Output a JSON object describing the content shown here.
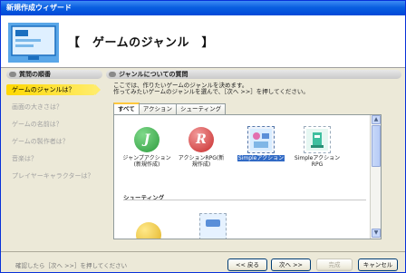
{
  "window": {
    "title": "新規作成ウィザード"
  },
  "banner": {
    "title": "【　ゲームのジャンル　】"
  },
  "sidebar": {
    "header": "質問の順番",
    "steps": [
      "ゲームのジャンルは？",
      "画面の大きさは？",
      "ゲームの名前は？",
      "ゲームの製作者は？",
      "音楽は？",
      "プレイヤーキャラクターは？"
    ],
    "active_index": 0
  },
  "main": {
    "header": "ジャンルについての質問",
    "instruction_line1": "ここでは、作りたいゲームのジャンルを決めます。",
    "instruction_line2": "作ってみたいゲームのジャンルを選んで、［次へ >>］を押してください。",
    "tabs": [
      "すべて",
      "アクション",
      "シューティング"
    ],
    "active_tab": 0,
    "items": [
      {
        "label": "ジャンプアクション(新規作成)",
        "icon": "jump-icon",
        "color": "#33a844",
        "letter": "J"
      },
      {
        "label": "アクションRPG(新規作成)",
        "icon": "rpg-icon",
        "color": "#d83434",
        "letter": "R"
      },
      {
        "label": "Simpleアクション",
        "icon": "simple-action-icon",
        "selected": true
      },
      {
        "label": "Simpleアクション RPG",
        "icon": "simple-action-rpg-icon"
      }
    ],
    "category_shooting": "シューティング"
  },
  "footer": {
    "status": "確認したら［次へ >>］を押してください",
    "back": "<< 戻る",
    "next": "次へ >>",
    "finish": "完成",
    "cancel": "キャンセル"
  },
  "colors": {
    "accent": "#ffd800",
    "titlebar": "#0a5fe0",
    "selection": "#316ac5"
  }
}
